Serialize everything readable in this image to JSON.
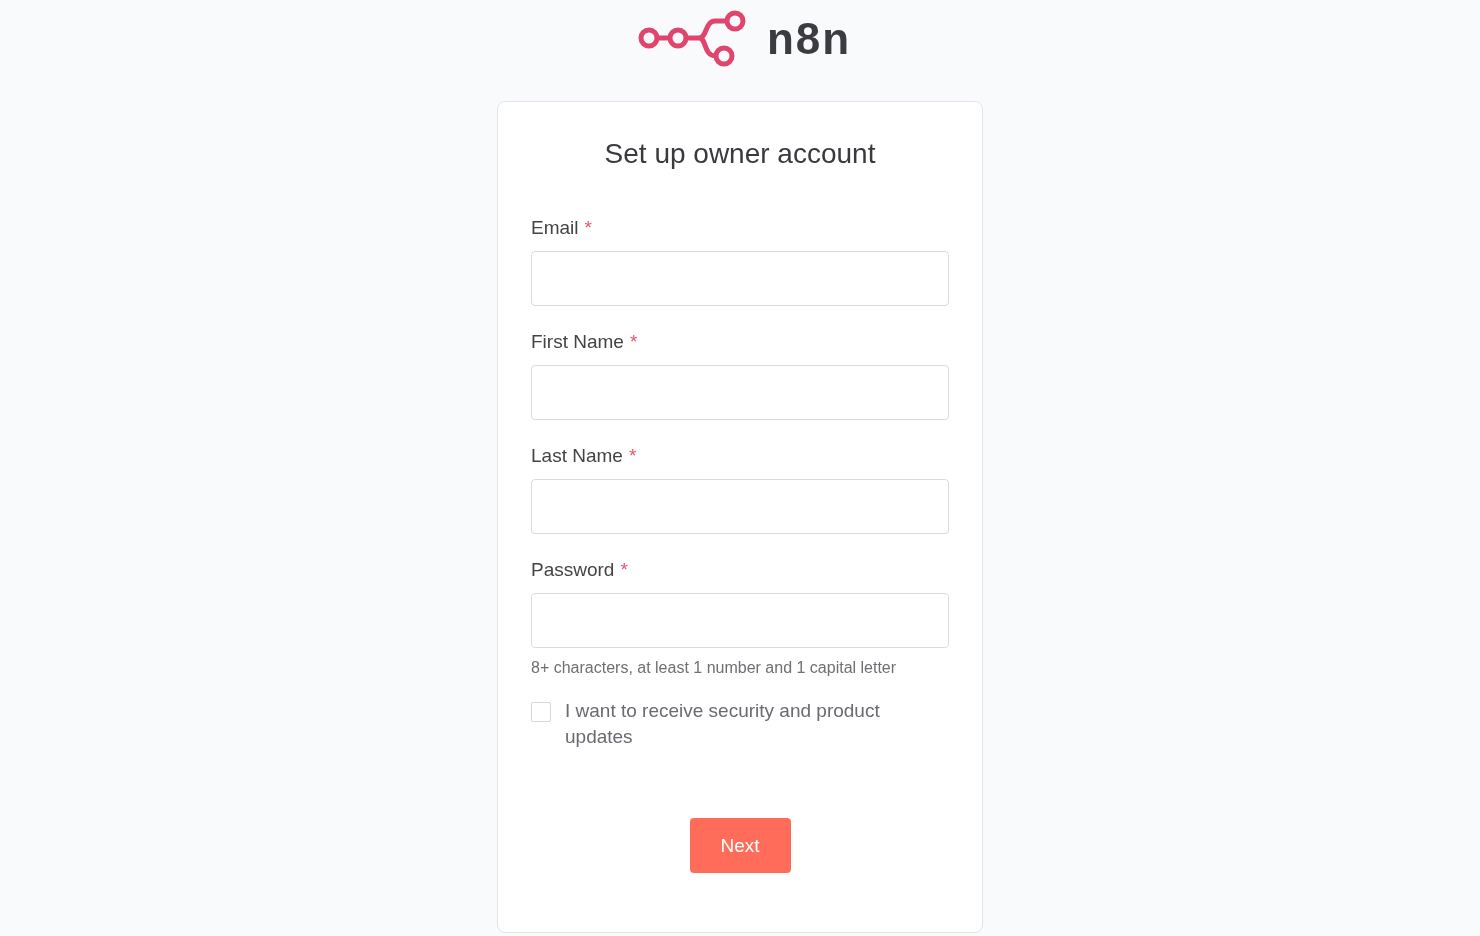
{
  "logo": {
    "name": "n8n"
  },
  "form": {
    "title": "Set up owner account",
    "fields": [
      {
        "label": "Email",
        "required_mark": "*"
      },
      {
        "label": "First Name",
        "required_mark": "*"
      },
      {
        "label": "Last Name",
        "required_mark": "*"
      },
      {
        "label": "Password",
        "required_mark": "*",
        "hint": "8+ characters, at least 1 number and 1 capital letter"
      }
    ],
    "consent": {
      "label": "I want to receive security and product updates",
      "checked": false
    },
    "submit": "Next"
  }
}
